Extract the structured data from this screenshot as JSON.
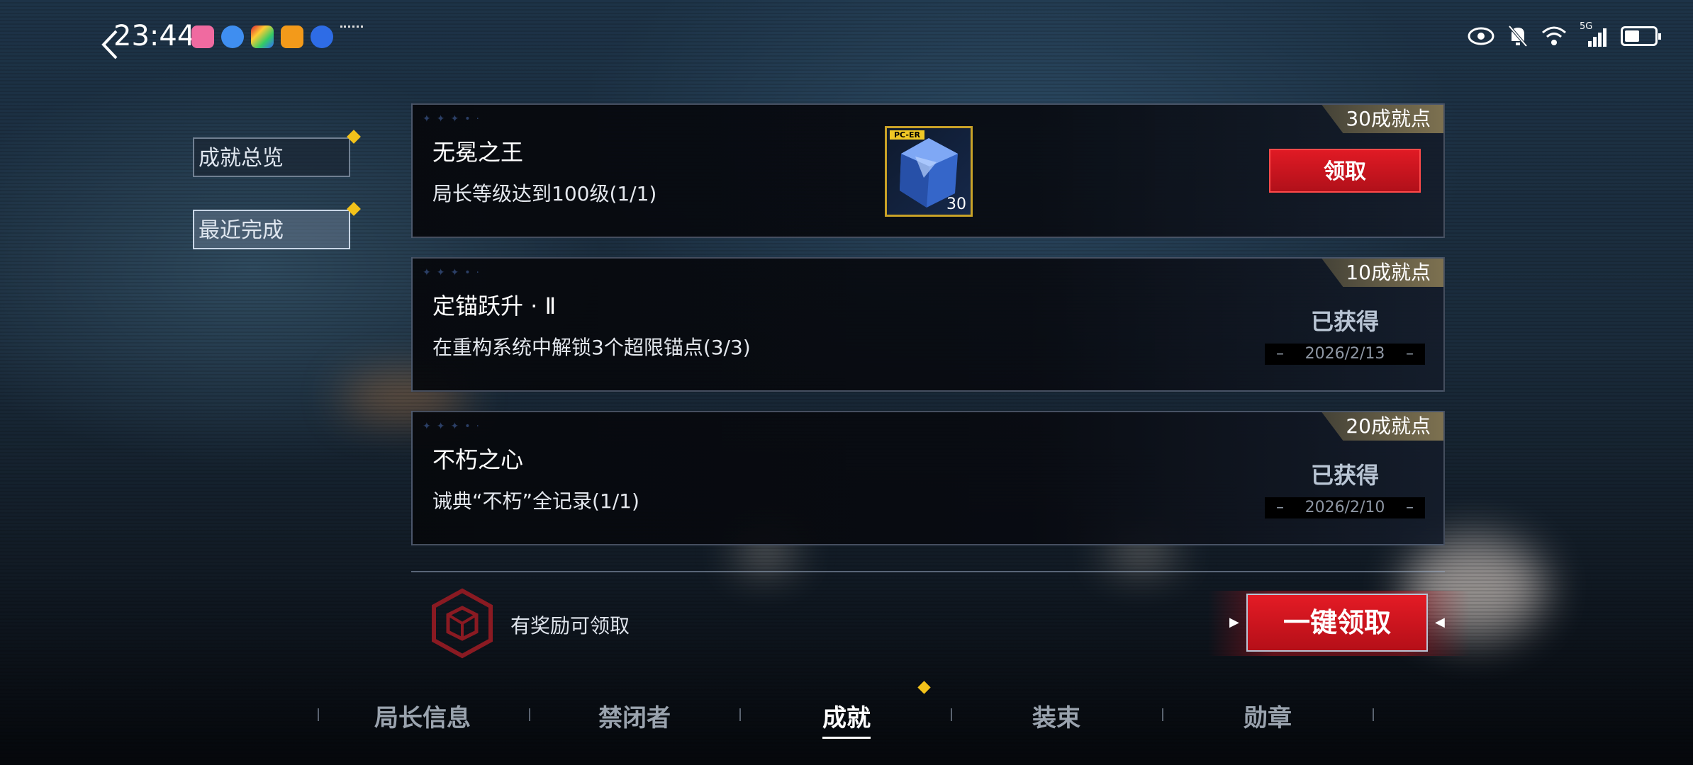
{
  "status_bar": {
    "time": "23:44",
    "network": "5G"
  },
  "side_menu": {
    "items": [
      {
        "label": "成就总览"
      },
      {
        "label": "最近完成"
      }
    ]
  },
  "achievements": [
    {
      "title": "无冕之王",
      "desc": "局长等级达到100级(1/1)",
      "points": "30成就点",
      "reward": {
        "tag": "PC-ER",
        "qty": "30"
      },
      "action": "领取"
    },
    {
      "title": "定锚跃升 · Ⅱ",
      "desc": "在重构系统中解锁3个超限锚点(3/3)",
      "points": "10成就点",
      "status": "已获得",
      "date": "2026/2/13"
    },
    {
      "title": "不朽之心",
      "desc": "诫典“不朽”全记录(1/1)",
      "points": "20成就点",
      "status": "已获得",
      "date": "2026/2/10"
    }
  ],
  "footer": {
    "hint": "有奖励可领取",
    "claim_all": "一键领取"
  },
  "bottom_nav": {
    "items": [
      "局长信息",
      "禁闭者",
      "成就",
      "装束",
      "勋章"
    ],
    "active": "成就"
  },
  "colors": {
    "accent_red": "#e01a24",
    "badge_gold": "#f3c21a",
    "points_bg": "#7d7150"
  }
}
